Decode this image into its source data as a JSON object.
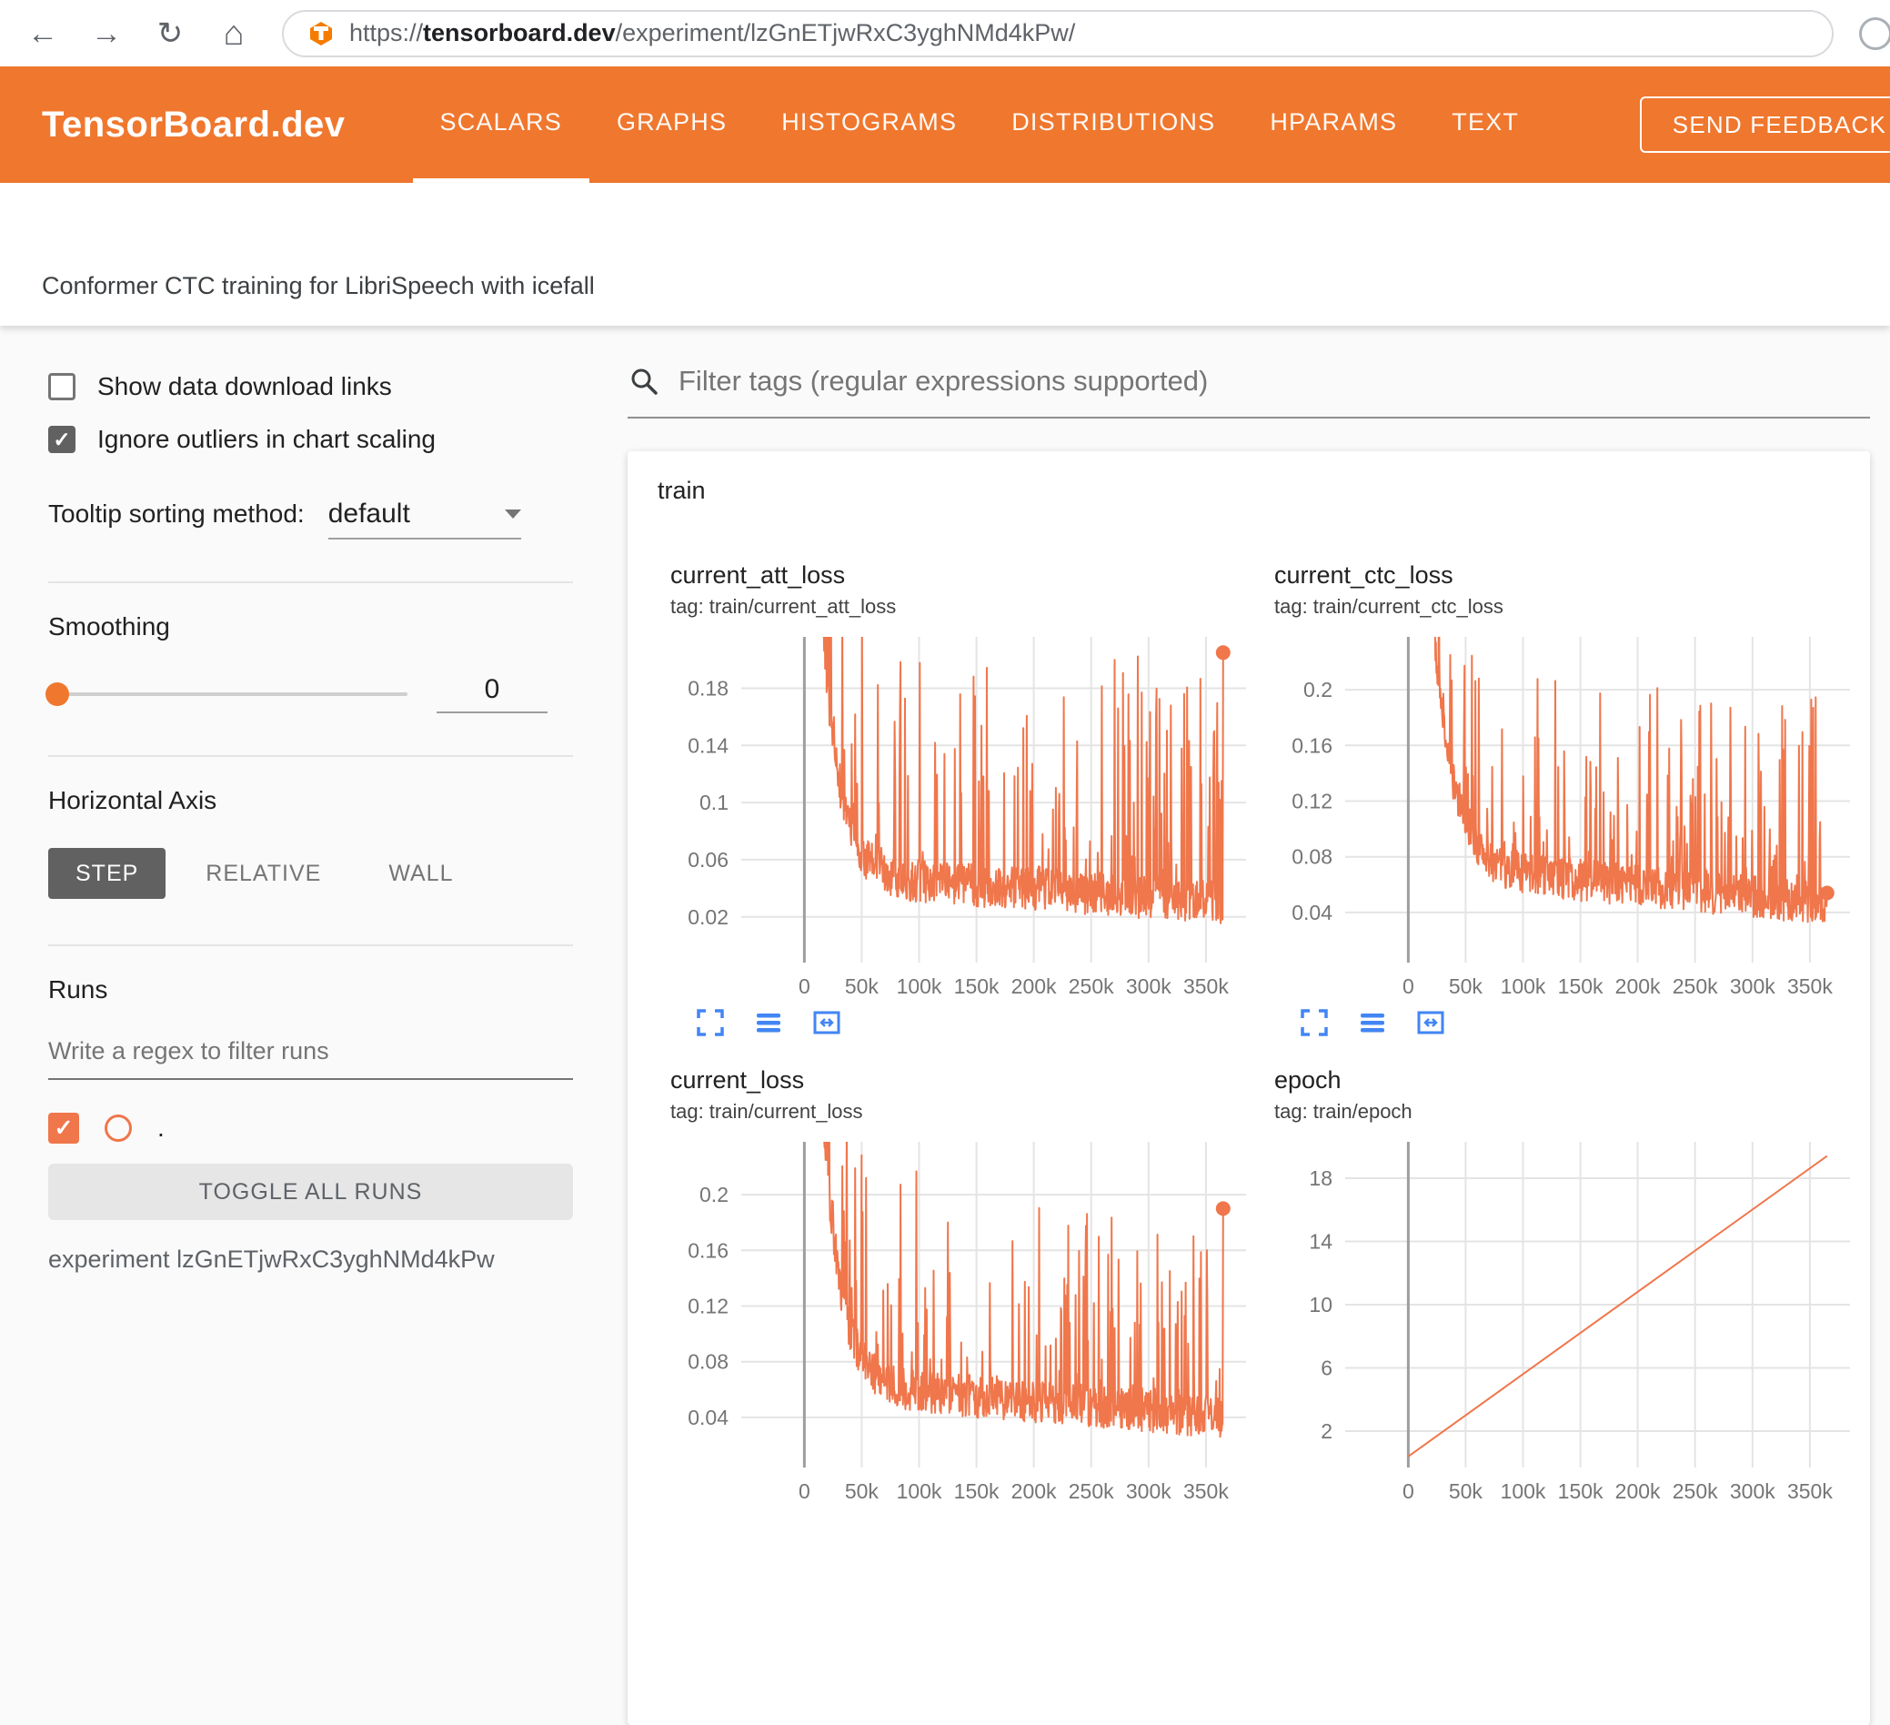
{
  "browser": {
    "url_scheme": "https://",
    "url_host": "tensorboard.dev",
    "url_path": "/experiment/lzGnETjwRxC3yghNMd4kPw/"
  },
  "icons": {
    "back": "←",
    "forward": "→",
    "reload": "↻",
    "home": "⌂"
  },
  "header": {
    "brand": "TensorBoard.dev",
    "tabs": [
      {
        "label": "SCALARS",
        "active": true
      },
      {
        "label": "GRAPHS",
        "active": false
      },
      {
        "label": "HISTOGRAMS",
        "active": false
      },
      {
        "label": "DISTRIBUTIONS",
        "active": false
      },
      {
        "label": "HPARAMS",
        "active": false
      },
      {
        "label": "TEXT",
        "active": false
      }
    ],
    "feedback_button": "SEND FEEDBACK"
  },
  "experiment_title": "Conformer CTC training for LibriSpeech with icefall",
  "sidebar": {
    "show_download": {
      "label": "Show data download links",
      "checked": false
    },
    "ignore_outliers": {
      "label": "Ignore outliers in chart scaling",
      "checked": true
    },
    "tooltip_sorting": {
      "label": "Tooltip sorting method:",
      "value": "default"
    },
    "smoothing": {
      "label": "Smoothing",
      "value": "0"
    },
    "horizontal_axis": {
      "label": "Horizontal Axis",
      "options": [
        "STEP",
        "RELATIVE",
        "WALL"
      ],
      "selected": "STEP"
    },
    "runs": {
      "label": "Runs",
      "filter_placeholder": "Write a regex to filter runs",
      "run_name": ".",
      "run_checked": true,
      "toggle_all": "TOGGLE ALL RUNS",
      "experiment": "experiment lzGnETjwRxC3yghNMd4kPw"
    }
  },
  "main": {
    "filter_placeholder": "Filter tags (regular expressions supported)",
    "section": "train"
  },
  "colors": {
    "header_orange": "#f0772e",
    "series_line": "#f0764b",
    "icon_blue": "#4285f4",
    "step_button_bg": "#616161",
    "grid_light": "#e4e4e4",
    "axis_dark": "#9e9e9e"
  },
  "chart_data": [
    {
      "type": "line",
      "title": "current_att_loss",
      "tag": "tag: train/current_att_loss",
      "series_desc": "noisy training loss: starts above 0.2 (clipped), decays to baseline ~0.05→0.03 with frequent spikes up to ~0.2; final point marked at ~0.205",
      "xlim": [
        -55000,
        385000
      ],
      "ylim": [
        -0.012,
        0.216
      ],
      "x_ticks": [
        0,
        50000,
        100000,
        150000,
        200000,
        250000,
        300000,
        350000
      ],
      "x_tick_labels": [
        "0",
        "50k",
        "100k",
        "150k",
        "200k",
        "250k",
        "300k",
        "350k"
      ],
      "y_ticks": [
        0.02,
        0.06,
        0.1,
        0.14,
        0.18
      ],
      "y_tick_labels": [
        "0.02",
        "0.06",
        "0.1",
        "0.14",
        "0.18"
      ],
      "gen": {
        "seed": 42,
        "n": 850,
        "x_end": 365000,
        "start": 0.55,
        "floor_start": 0.05,
        "floor_end": 0.03,
        "tau": 15000,
        "jitter": 0.015,
        "spike_prob": 0.22,
        "spike_max": 0.165,
        "spike_pow": 1.8
      },
      "end_marker": {
        "x": 365000,
        "y": 0.205
      }
    },
    {
      "type": "line",
      "title": "current_ctc_loss",
      "tag": "tag: train/current_ctc_loss",
      "series_desc": "noisy training loss: starts high (clipped), decays to baseline ~0.075→0.046 with spikes up to ~0.2; final point marked at ~0.054",
      "xlim": [
        -55000,
        385000
      ],
      "ylim": [
        0.004,
        0.238
      ],
      "x_ticks": [
        0,
        50000,
        100000,
        150000,
        200000,
        250000,
        300000,
        350000
      ],
      "x_tick_labels": [
        "0",
        "50k",
        "100k",
        "150k",
        "200k",
        "250k",
        "300k",
        "350k"
      ],
      "y_ticks": [
        0.04,
        0.08,
        0.12,
        0.16,
        0.2
      ],
      "y_tick_labels": [
        "0.04",
        "0.08",
        "0.12",
        "0.16",
        "0.2"
      ],
      "gen": {
        "seed": 7,
        "n": 850,
        "x_end": 365000,
        "start": 0.7,
        "floor_start": 0.075,
        "floor_end": 0.046,
        "tau": 17000,
        "jitter": 0.015,
        "spike_prob": 0.2,
        "spike_max": 0.145,
        "spike_pow": 1.8
      },
      "end_marker": {
        "x": 365000,
        "y": 0.054
      }
    },
    {
      "type": "line",
      "title": "current_loss",
      "tag": "tag: train/current_loss",
      "series_desc": "noisy training loss: starts high (clipped), decays to baseline ~0.065→0.04 with spikes up to ~0.2; final point marked at ~0.19",
      "xlim": [
        -55000,
        385000
      ],
      "ylim": [
        0.004,
        0.238
      ],
      "x_ticks": [
        0,
        50000,
        100000,
        150000,
        200000,
        250000,
        300000,
        350000
      ],
      "x_tick_labels": [
        "0",
        "50k",
        "100k",
        "150k",
        "200k",
        "250k",
        "300k",
        "350k"
      ],
      "y_ticks": [
        0.04,
        0.08,
        0.12,
        0.16,
        0.2
      ],
      "y_tick_labels": [
        "0.04",
        "0.08",
        "0.12",
        "0.16",
        "0.2"
      ],
      "gen": {
        "seed": 13,
        "n": 850,
        "x_end": 365000,
        "start": 0.65,
        "floor_start": 0.065,
        "floor_end": 0.04,
        "tau": 15000,
        "jitter": 0.015,
        "spike_prob": 0.21,
        "spike_max": 0.155,
        "spike_pow": 1.8
      },
      "end_marker": {
        "x": 365000,
        "y": 0.19
      }
    },
    {
      "type": "line",
      "title": "epoch",
      "tag": "tag: train/epoch",
      "series_desc": "epoch counter rising linearly from ~0 at step 0 to ~19.4 at step ~365k",
      "xlim": [
        -55000,
        385000
      ],
      "ylim": [
        -0.3,
        20.3
      ],
      "x_ticks": [
        0,
        50000,
        100000,
        150000,
        200000,
        250000,
        300000,
        350000
      ],
      "x_tick_labels": [
        "0",
        "50k",
        "100k",
        "150k",
        "200k",
        "250k",
        "300k",
        "350k"
      ],
      "y_ticks": [
        2,
        6,
        10,
        14,
        18
      ],
      "y_tick_labels": [
        "2",
        "6",
        "10",
        "14",
        "18"
      ],
      "points": [
        [
          0,
          0.4
        ],
        [
          365000,
          19.4
        ]
      ]
    }
  ]
}
